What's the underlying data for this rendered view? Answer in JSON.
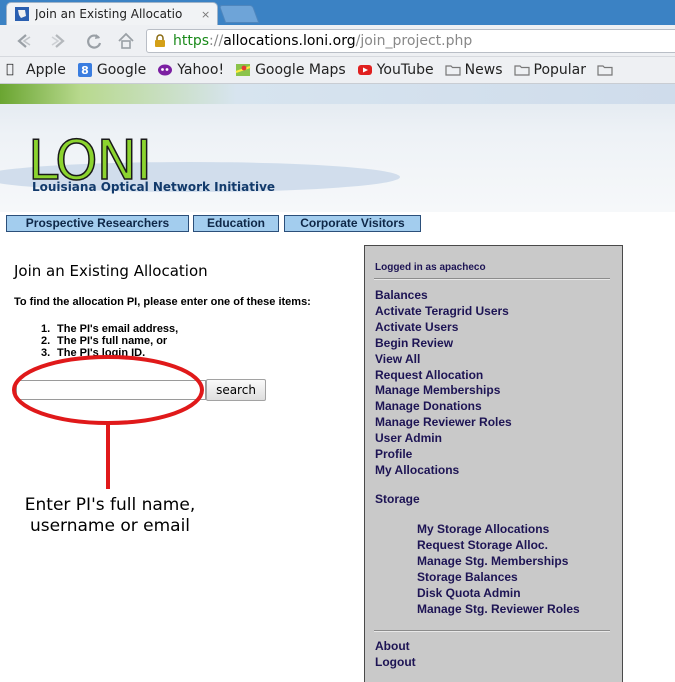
{
  "browser": {
    "tab_title": "Join an Existing Allocatio",
    "tab_close": "×",
    "url_scheme": "https",
    "url_sep": "://",
    "url_host": "allocations.loni.org",
    "url_path": "/join_project.php",
    "back_icon": "back-arrow-icon",
    "forward_icon": "forward-arrow-icon",
    "bookmarks": [
      {
        "label": "Apple",
        "icon": "apple-icon"
      },
      {
        "label": "Google",
        "icon": "google-icon"
      },
      {
        "label": "Yahoo!",
        "icon": "yahoo-icon"
      },
      {
        "label": "Google Maps",
        "icon": "maps-icon"
      },
      {
        "label": "YouTube",
        "icon": "youtube-icon"
      },
      {
        "label": "News",
        "icon": "folder-icon"
      },
      {
        "label": "Popular",
        "icon": "folder-icon"
      }
    ]
  },
  "banner": {
    "logo": "LONI",
    "subtitle": "Louisiana Optical Network Initiative"
  },
  "nav": [
    {
      "label": "Prospective Researchers"
    },
    {
      "label": "Education"
    },
    {
      "label": "Corporate Visitors"
    }
  ],
  "main": {
    "title": "Join an Existing Allocation",
    "intro": "To find the allocation PI, please enter one of these items:",
    "items": [
      {
        "num": "1.",
        "text": "The PI's email address,"
      },
      {
        "num": "2.",
        "text": "The PI's full name, or"
      },
      {
        "num": "3.",
        "text": "The PI's login ID."
      }
    ],
    "search_value": "",
    "search_button": "search"
  },
  "annotation": {
    "line1": "Enter PI's full name,",
    "line2": "username or email",
    "color": "#e0191a"
  },
  "sidebar": {
    "logged_in": "Logged in as apacheco",
    "links": [
      "Balances",
      "Activate Teragrid Users",
      "Activate Users",
      "Begin Review",
      "View All",
      "Request Allocation",
      "Manage Memberships",
      "Manage Donations",
      "Manage Reviewer Roles",
      "User Admin",
      "Profile",
      "My Allocations"
    ],
    "storage_heading": "Storage",
    "storage_links": [
      "My Storage Allocations",
      "Request Storage Alloc.",
      "Manage Stg. Memberships",
      "Storage Balances",
      "Disk Quota Admin",
      "Manage Stg. Reviewer Roles"
    ],
    "bottom_links": [
      "About",
      "Logout"
    ]
  },
  "colors": {
    "tabstrip": "#3b82c4",
    "logo_green": "#8cd42f",
    "nav_bg": "#a3cdee",
    "sidebar_bg": "#c9c9c9",
    "sidebar_link": "#1d1454",
    "annotation_red": "#e0191a"
  }
}
